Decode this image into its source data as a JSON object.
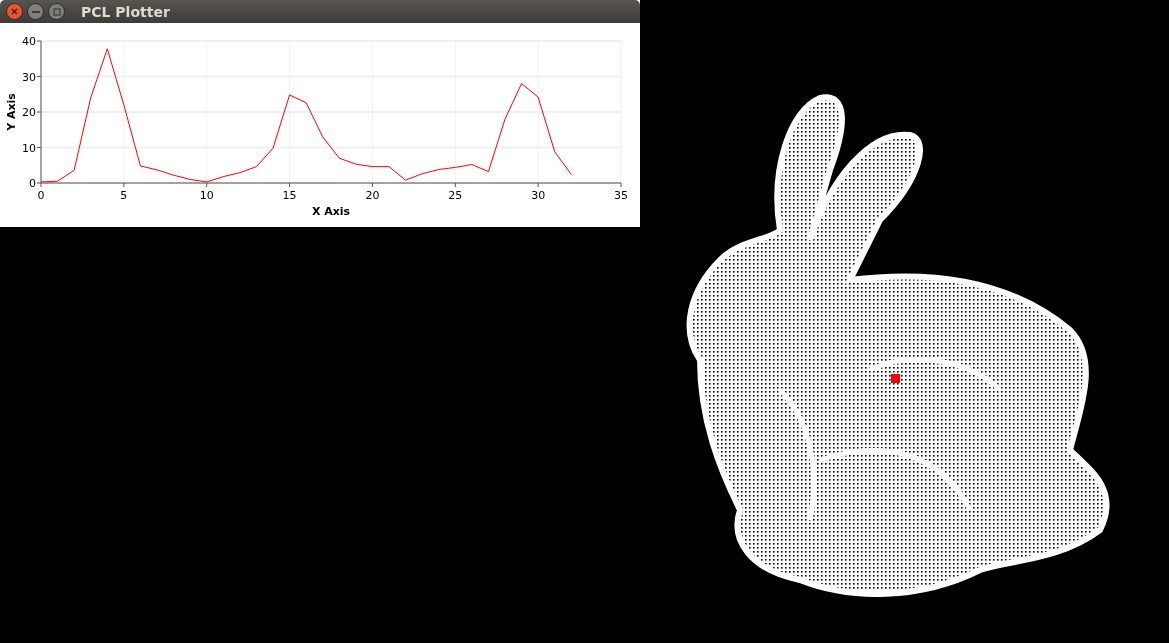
{
  "window": {
    "title": "PCL Plotter"
  },
  "plot": {
    "chart_data": {
      "type": "line",
      "grid": true,
      "xlabel": "X Axis",
      "ylabel": "Y Axis",
      "xlim": [
        0,
        35
      ],
      "ylim": [
        0,
        40
      ],
      "xticks": [
        0,
        5,
        10,
        15,
        20,
        25,
        30,
        35
      ],
      "yticks": [
        0,
        10,
        20,
        30,
        40
      ],
      "x": [
        0,
        1,
        2,
        3,
        4,
        5,
        6,
        7,
        8,
        9,
        10,
        11,
        12,
        13,
        14,
        15,
        16,
        17,
        18,
        19,
        20,
        21,
        22,
        23,
        24,
        25,
        26,
        27,
        28,
        29,
        30,
        31,
        32
      ],
      "series": [
        {
          "color": "#ff0000",
          "values": [
            0.3,
            0.5,
            3.6,
            24,
            37.8,
            22,
            4.8,
            3.7,
            2.2,
            1,
            0.3,
            1.8,
            2.9,
            4.6,
            9.8,
            24.8,
            22.6,
            13,
            7,
            5.3,
            4.6,
            4.6,
            0.8,
            2.6,
            3.8,
            4.4,
            5.2,
            3.2,
            18,
            28,
            24.2,
            8.8,
            2.4
          ]
        }
      ]
    }
  }
}
